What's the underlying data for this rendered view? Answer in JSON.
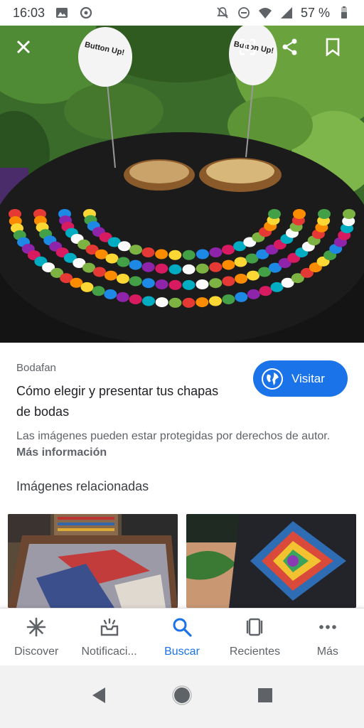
{
  "status_bar": {
    "time": "16:03",
    "battery": "57 %",
    "icons": [
      "image-icon",
      "assistant-icon",
      "mute-icon",
      "dnd-icon",
      "wifi-icon",
      "signal-icon",
      "battery-icon"
    ]
  },
  "hero": {
    "sign_text_left": "Button Up!",
    "sign_text_right": "Button Up!",
    "close_icon": "close-icon",
    "lens_icon": "lens-icon",
    "share_icon": "share-icon",
    "bookmark_icon": "bookmark-icon"
  },
  "result": {
    "source": "Bodafan",
    "title": "Cómo elegir y presentar tus chapas de bodas",
    "visit_label": "Visitar",
    "copyright_text": "Las imágenes pueden estar protegidas por derechos de autor.",
    "more_info_label": "Más información"
  },
  "related": {
    "heading": "Imágenes relacionadas"
  },
  "bottom_nav": {
    "items": [
      {
        "label": "Discover",
        "icon": "asterisk-icon"
      },
      {
        "label": "Notificaci...",
        "icon": "notifications-icon"
      },
      {
        "label": "Buscar",
        "icon": "search-icon"
      },
      {
        "label": "Recientes",
        "icon": "recents-icon"
      },
      {
        "label": "Más",
        "icon": "more-icon"
      }
    ],
    "active_index": 2
  },
  "colors": {
    "accent": "#1a73e8",
    "text_primary": "#202124",
    "text_secondary": "#5f6368"
  }
}
